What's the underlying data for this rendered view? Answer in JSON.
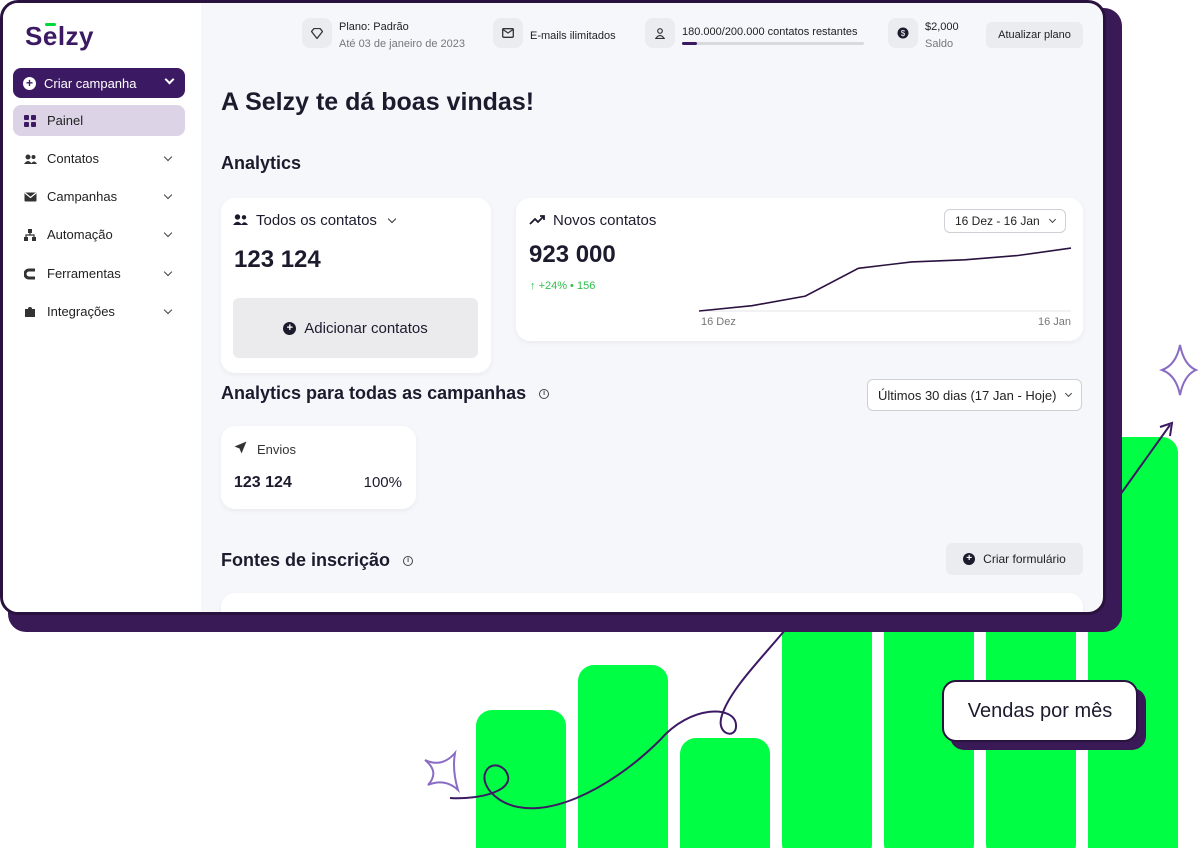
{
  "brand": {
    "logo": "Selzy",
    "accent": "#3c1a63",
    "green": "#00ff44"
  },
  "topbar": {
    "plan_label": "Plano: Padrão",
    "plan_until": "Até 03 de janeiro de 2023",
    "emails": "E-mails ilimitados",
    "contacts": "180.000/200.000 contatos restantes",
    "contacts_progress": 0.08,
    "balance": "$2,000",
    "balance_label": "Saldo",
    "upgrade": "Atualizar plano"
  },
  "sidebar": {
    "create": "Criar campanha",
    "items": [
      {
        "label": "Painel",
        "icon": "grid-icon"
      },
      {
        "label": "Contatos",
        "icon": "users-icon"
      },
      {
        "label": "Campanhas",
        "icon": "mail-icon"
      },
      {
        "label": "Automação",
        "icon": "flow-icon"
      },
      {
        "label": "Ferramentas",
        "icon": "magnet-icon"
      },
      {
        "label": "Integrações",
        "icon": "puzzle-icon"
      }
    ]
  },
  "main": {
    "welcome": "A Selzy te dá boas vindas!",
    "analytics_title": "Analytics",
    "contacts_card": {
      "title": "Todos os contatos",
      "value": "123 124",
      "add": "Adicionar contatos"
    },
    "new_contacts": {
      "title": "Novos contatos",
      "value": "923 000",
      "delta": "+24% • 156",
      "range": "16 Dez - 16 Jan",
      "x_start": "16 Dez",
      "x_end": "16 Jan"
    },
    "campaigns_title": "Analytics para todas as campanhas",
    "campaigns_range": "Últimos 30 dias (17 Jan - Hoje)",
    "envios": {
      "label": "Envios",
      "value": "123 124",
      "percent": "100%"
    },
    "sources_title": "Fontes de inscrição",
    "create_form": "Criar formulário"
  },
  "chart_data": {
    "type": "line",
    "x": [
      "16 Dez",
      "",
      "",
      "",
      "",
      "",
      "",
      "16 Jan"
    ],
    "series": [
      {
        "values": [
          0,
          5,
          14,
          40,
          46,
          48,
          52,
          59
        ]
      }
    ],
    "ylim": [
      0,
      60
    ]
  },
  "decor": {
    "vendas_label": "Vendas por mês"
  }
}
